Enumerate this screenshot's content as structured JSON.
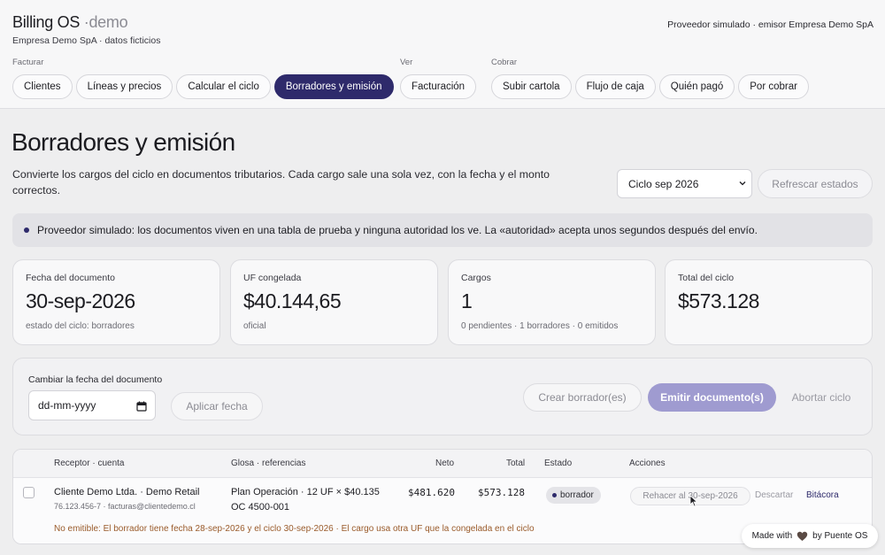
{
  "app": {
    "brand": "Billing OS",
    "brand_sep": "·",
    "brand_suffix": "demo",
    "subtitle": "Empresa Demo SpA · datos ficticios",
    "provider_info": "Proveedor simulado · emisor Empresa Demo SpA"
  },
  "nav": {
    "groups": [
      {
        "label": "Facturar",
        "items": [
          "Clientes",
          "Líneas y precios",
          "Calcular el ciclo",
          "Borradores y emisión"
        ]
      },
      {
        "label": "Ver",
        "items": [
          "Facturación"
        ]
      },
      {
        "label": "Cobrar",
        "items": [
          "Subir cartola",
          "Flujo de caja",
          "Quién pagó",
          "Por cobrar"
        ]
      }
    ],
    "active": "Borradores y emisión"
  },
  "page": {
    "title": "Borradores y emisión",
    "description": "Convierte los cargos del ciclo en documentos tributarios. Cada cargo sale una sola vez, con la fecha y el monto correctos.",
    "cycle_select": "Ciclo sep 2026",
    "refresh_button": "Refrescar estados",
    "notice": "Proveedor simulado: los documentos viven en una tabla de prueba y ninguna autoridad los ve. La «autoridad» acepta unos segundos después del envío."
  },
  "stats": [
    {
      "label": "Fecha del documento",
      "value": "30-sep-2026",
      "sub": "estado del ciclo: borradores"
    },
    {
      "label": "UF congelada",
      "value": "$40.144,65",
      "sub": "oficial"
    },
    {
      "label": "Cargos",
      "value": "1",
      "sub": "0 pendientes · 1 borradores · 0 emitidos"
    },
    {
      "label": "Total del ciclo",
      "value": "$573.128",
      "sub": ""
    }
  ],
  "actions": {
    "date_label": "Cambiar la fecha del documento",
    "date_placeholder": "dd-mm-yyyy",
    "apply_button": "Aplicar fecha",
    "create_button": "Crear borrador(es)",
    "emit_button": "Emitir documento(s)",
    "abort_button": "Abortar ciclo"
  },
  "table": {
    "columns": [
      "Receptor · cuenta",
      "Glosa · referencias",
      "Neto",
      "Total",
      "Estado",
      "Acciones"
    ],
    "rows": [
      {
        "receiver": "Cliente Demo Ltda. · Demo Retail",
        "receiver_sub": "76.123.456-7 · facturas@clientedemo.cl",
        "gloss": "Plan Operación · 12 UF × $40.135",
        "gloss_sub": "OC 4500-001",
        "net": "$481.620",
        "total": "$573.128",
        "status": "borrador",
        "redo": "Rehacer al 30-sep-2026",
        "discard": "Descartar",
        "log": "Bitácora",
        "warning": "No emitible: El borrador tiene fecha 28-sep-2026 y el ciclo 30-sep-2026 · El cargo usa otra UF que la congelada en el ciclo"
      }
    ]
  },
  "footer": {
    "made_with": "Made with",
    "by": "by Puente OS"
  },
  "colors": {
    "accent": "#2e2a6b",
    "accent_light": "#9f9bd0",
    "warning": "#9a5b2b"
  },
  "icons": [
    "chevron-down-icon",
    "calendar-icon",
    "heart-icon",
    "status-dot-icon",
    "cursor-icon"
  ]
}
